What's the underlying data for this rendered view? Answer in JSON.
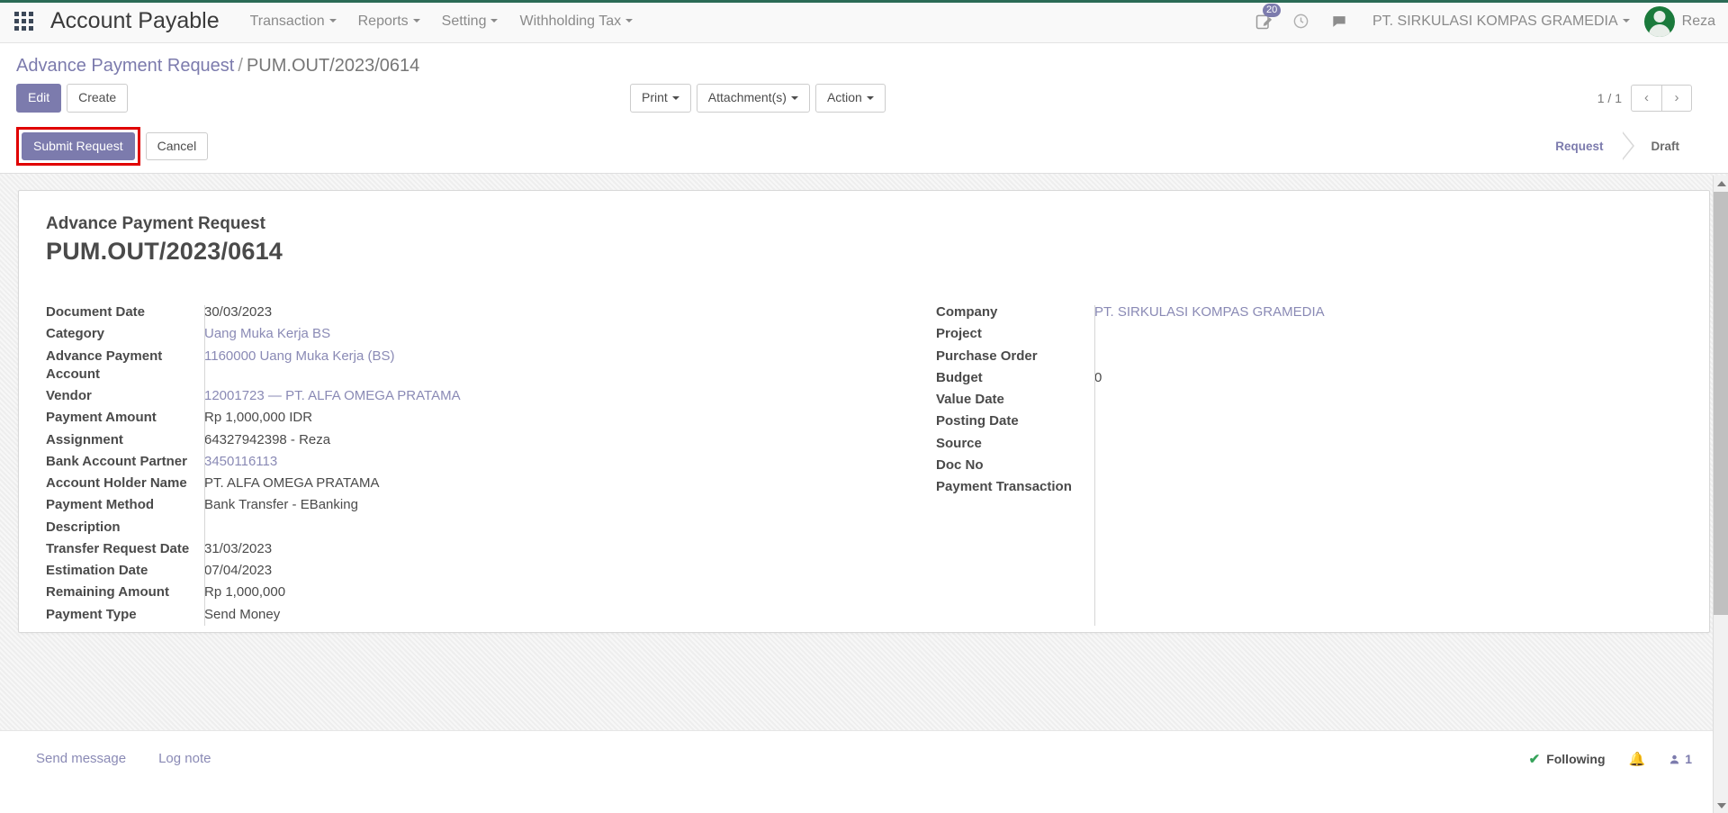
{
  "navbar": {
    "apps_icon": "apps-grid-icon",
    "brand": "Account Payable",
    "menus": [
      {
        "label": "Transaction"
      },
      {
        "label": "Reports"
      },
      {
        "label": "Setting"
      },
      {
        "label": "Withholding Tax"
      }
    ],
    "activities_badge": "20",
    "activities_icon": "clipboard-pencil-icon",
    "clock_icon": "clock-icon",
    "messages_icon": "chat-bubble-icon",
    "company": "PT. SIRKULASI KOMPAS GRAMEDIA",
    "user_name": "Reza",
    "accent_color": "#7c7bad",
    "topbar_color": "#2b6b56"
  },
  "breadcrumb": {
    "parent": "Advance Payment Request",
    "separator": "/",
    "current": "PUM.OUT/2023/0614"
  },
  "control_panel": {
    "edit_label": "Edit",
    "create_label": "Create",
    "print_label": "Print",
    "attachments_label": "Attachment(s)",
    "action_label": "Action",
    "pager_text": "1 / 1",
    "prev_icon": "chevron-left-icon",
    "next_icon": "chevron-right-icon"
  },
  "status_bar": {
    "submit_label": "Submit Request",
    "cancel_label": "Cancel",
    "highlight_color": "#e00000",
    "stages": [
      {
        "label": "Request",
        "state": "done"
      },
      {
        "label": "Draft",
        "state": "current"
      }
    ]
  },
  "form": {
    "title_small": "Advance Payment Request",
    "title_big": "PUM.OUT/2023/0614",
    "left_fields": [
      {
        "label": "Document Date",
        "value": "30/03/2023",
        "link": false
      },
      {
        "label": "Category",
        "value": "Uang Muka Kerja BS",
        "link": true
      },
      {
        "label": "Advance Payment Account",
        "value": "1160000 Uang Muka Kerja (BS)",
        "link": true
      },
      {
        "label": "Vendor",
        "value": "12001723 — PT. ALFA OMEGA PRATAMA",
        "link": true
      },
      {
        "label": "Payment Amount",
        "value": "Rp 1,000,000  IDR",
        "link": false
      },
      {
        "label": "Assignment",
        "value": "64327942398 - Reza",
        "link": false
      },
      {
        "label": "Bank Account Partner",
        "value": "3450116113",
        "link": true
      },
      {
        "label": "Account Holder Name",
        "value": "PT. ALFA OMEGA PRATAMA",
        "link": false
      },
      {
        "label": "Payment Method",
        "value": "Bank Transfer - EBanking",
        "link": false
      },
      {
        "label": "Description",
        "value": "",
        "link": false
      },
      {
        "label": "Transfer Request Date",
        "value": "31/03/2023",
        "link": false
      },
      {
        "label": "Estimation Date",
        "value": "07/04/2023",
        "link": false
      },
      {
        "label": "Remaining Amount",
        "value": "Rp 1,000,000",
        "link": false
      },
      {
        "label": "Payment Type",
        "value": "Send Money",
        "link": false
      }
    ],
    "right_fields": [
      {
        "label": "Company",
        "value": "PT. SIRKULASI KOMPAS GRAMEDIA",
        "link": true
      },
      {
        "label": "Project",
        "value": "",
        "link": false
      },
      {
        "label": "Purchase Order",
        "value": "",
        "link": false
      },
      {
        "label": "Budget",
        "value": "0",
        "link": false
      },
      {
        "label": "Value Date",
        "value": "",
        "link": false
      },
      {
        "label": "Posting Date",
        "value": "",
        "link": false
      },
      {
        "label": "Source",
        "value": "",
        "link": false
      },
      {
        "label": "Doc No",
        "value": "",
        "link": false
      },
      {
        "label": "Payment Transaction",
        "value": "",
        "link": false
      }
    ]
  },
  "chatter": {
    "send_message_label": "Send message",
    "log_note_label": "Log note",
    "following_label": "Following",
    "check_icon": "check-icon",
    "bell_icon": "bell-icon",
    "follower_icon": "user-icon",
    "follower_count": "1"
  }
}
